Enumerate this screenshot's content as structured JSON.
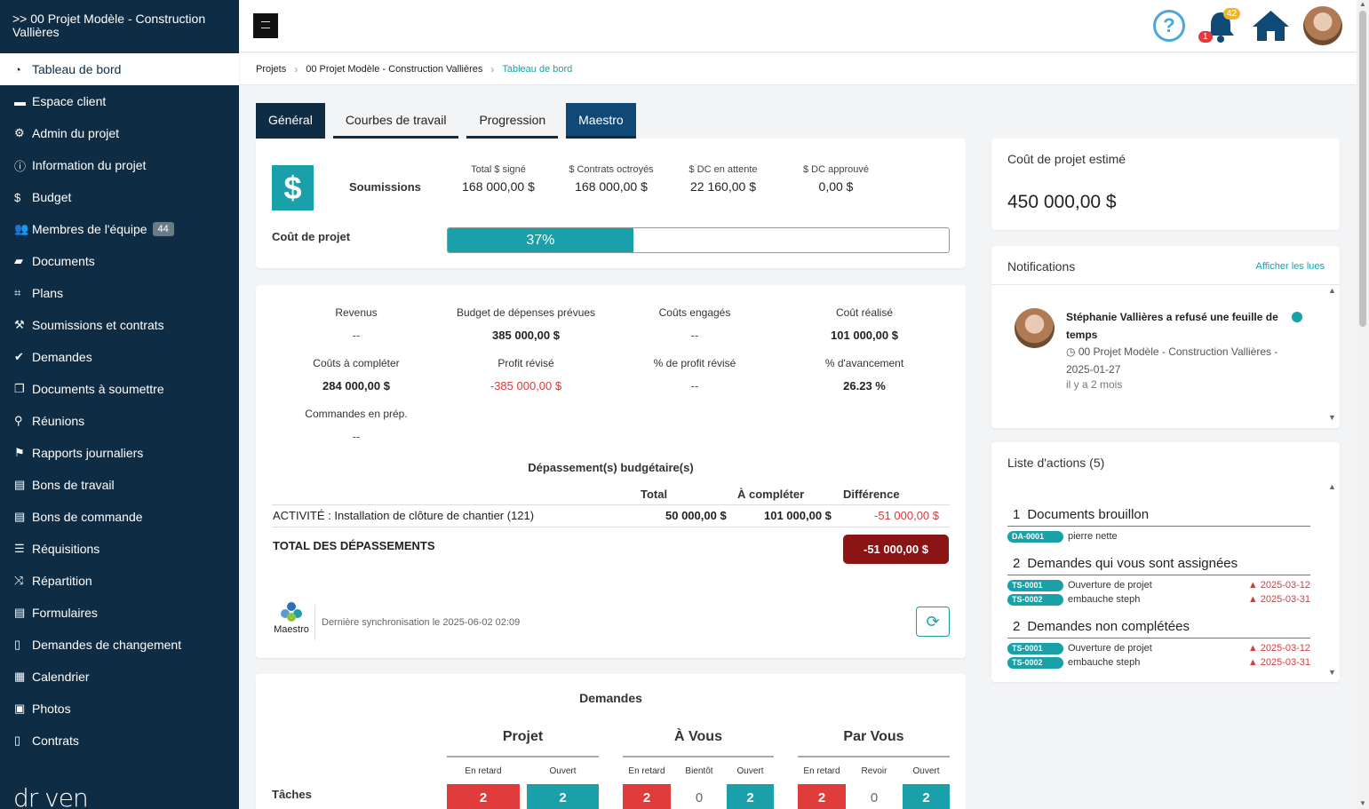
{
  "sidebar": {
    "project_title": ">> 00 Projet Modèle - Construction Vallières",
    "items": [
      {
        "label": "Tableau de bord",
        "icon": "dashboard-icon",
        "active": true
      },
      {
        "label": "Espace client",
        "icon": "briefcase-icon"
      },
      {
        "label": "Admin du projet",
        "icon": "gear-icon"
      },
      {
        "label": "Information du projet",
        "icon": "info-icon"
      },
      {
        "label": "Budget",
        "icon": "dollar-icon"
      },
      {
        "label": "Membres de l'équipe",
        "icon": "users-icon",
        "badge": "44"
      },
      {
        "label": "Documents",
        "icon": "folder-icon"
      },
      {
        "label": "Plans",
        "icon": "crop-icon"
      },
      {
        "label": "Soumissions et contrats",
        "icon": "hammer-icon"
      },
      {
        "label": "Demandes",
        "icon": "check-icon"
      },
      {
        "label": "Documents à soumettre",
        "icon": "copy-icon"
      },
      {
        "label": "Réunions",
        "icon": "map-marker-icon"
      },
      {
        "label": "Rapports journaliers",
        "icon": "flag-icon"
      },
      {
        "label": "Bons de travail",
        "icon": "file-icon"
      },
      {
        "label": "Bons de commande",
        "icon": "file-icon"
      },
      {
        "label": "Réquisitions",
        "icon": "list-icon"
      },
      {
        "label": "Répartition",
        "icon": "shuffle-icon"
      },
      {
        "label": "Formulaires",
        "icon": "form-icon"
      },
      {
        "label": "Demandes de changement",
        "icon": "file-outline-icon"
      },
      {
        "label": "Calendrier",
        "icon": "calendar-icon"
      },
      {
        "label": "Photos",
        "icon": "image-icon"
      },
      {
        "label": "Contrats",
        "icon": "file-outline-icon"
      }
    ],
    "brand": "dr ven"
  },
  "header": {
    "help_label": "?",
    "notif_count_yellow": "42",
    "notif_count_red": "1"
  },
  "breadcrumb": [
    "Projets",
    "00 Projet Modèle - Construction Vallières",
    "Tableau de bord"
  ],
  "tabs": [
    "Général",
    "Courbes de travail",
    "Progression",
    "Maestro"
  ],
  "submissions": {
    "icon_symbol": "$",
    "label": "Soumissions",
    "metrics": [
      {
        "label": "Total $ signé",
        "value": "168 000,00 $"
      },
      {
        "label": "$ Contrats octroyés",
        "value": "168 000,00 $"
      },
      {
        "label": "$ DC en attente",
        "value": "22 160,00 $"
      },
      {
        "label": "$ DC approuvé",
        "value": "0,00 $"
      }
    ],
    "cost_label": "Coût de projet",
    "progress_percent": 37,
    "progress_text": "37%"
  },
  "financials": {
    "stats": [
      {
        "label": "Revenus",
        "value": "--"
      },
      {
        "label": "Budget de dépenses prévues",
        "value": "385 000,00 $"
      },
      {
        "label": "Coûts engagés",
        "value": "--"
      },
      {
        "label": "Coût réalisé",
        "value": "101 000,00 $"
      },
      {
        "label": "Coûts à compléter",
        "value": "284 000,00 $"
      },
      {
        "label": "Profit révisé",
        "value": "-385 000,00 $"
      },
      {
        "label": "% de profit révisé",
        "value": "--"
      },
      {
        "label": "% d'avancement",
        "value": "26.23 %"
      },
      {
        "label": "Commandes en prép.",
        "value": "--"
      }
    ],
    "overrun_title": "Dépassement(s) budgétaire(s)",
    "overrun_headers": [
      "Total",
      "À compléter",
      "Différence"
    ],
    "overrun_row": {
      "label": "ACTIVITÉ : Installation de clôture de chantier (121)",
      "total": "50 000,00 $",
      "to_complete": "101 000,00 $",
      "difference": "-51 000,00 $"
    },
    "total_label": "TOTAL DES DÉPASSEMENTS",
    "total_value": "-51 000,00 $",
    "maestro_name": "Maestro",
    "sync_text": "Dernière synchronisation le 2025-06-02 02:09",
    "sync_icon": "refresh-icon"
  },
  "demandes": {
    "title": "Demandes",
    "row_label": "Tâches",
    "groups": [
      {
        "name": "Projet",
        "columns": [
          {
            "label": "En retard",
            "value": "2"
          },
          {
            "label": "Ouvert",
            "value": "2"
          }
        ]
      },
      {
        "name": "À Vous",
        "columns": [
          {
            "label": "En retard",
            "value": "2"
          },
          {
            "label": "Bientôt",
            "value": "0"
          },
          {
            "label": "Ouvert",
            "value": "2"
          }
        ]
      },
      {
        "name": "Par Vous",
        "columns": [
          {
            "label": "En retard",
            "value": "2"
          },
          {
            "label": "Revoir",
            "value": "0"
          },
          {
            "label": "Ouvert",
            "value": "2"
          }
        ]
      }
    ]
  },
  "cost_card": {
    "label": "Coût de projet estimé",
    "value": "450 000,00 $"
  },
  "notifications": {
    "title": "Notifications",
    "link": "Afficher les lues",
    "item": {
      "title": "Stéphanie Vallières a refusé une feuille de temps",
      "sub": "00 Projet Modèle - Construction Vallières - 2025-01-27",
      "time": "il y a 2 mois"
    }
  },
  "actions": {
    "title": "Liste d'actions (5)",
    "sections": [
      {
        "num": "1",
        "title": "Documents brouillon",
        "items": [
          {
            "code": "DA-0001",
            "text": "pierre nette",
            "date": ""
          }
        ]
      },
      {
        "num": "2",
        "title": "Demandes qui vous sont assignées",
        "items": [
          {
            "code": "TS-0001",
            "text": "Ouverture de projet",
            "date": "2025-03-12"
          },
          {
            "code": "TS-0002",
            "text": "embauche steph",
            "date": "2025-03-31"
          }
        ]
      },
      {
        "num": "2",
        "title": "Demandes non complétées",
        "items": [
          {
            "code": "TS-0001",
            "text": "Ouverture de projet",
            "date": "2025-03-12"
          },
          {
            "code": "TS-0002",
            "text": "embauche steph",
            "date": "2025-03-31"
          }
        ]
      }
    ]
  },
  "colors": {
    "sidebar_bg": "#0e2d45",
    "accent_teal": "#1aa0a8",
    "danger_red": "#e03c3c",
    "overrun_badge": "#8b1515"
  }
}
